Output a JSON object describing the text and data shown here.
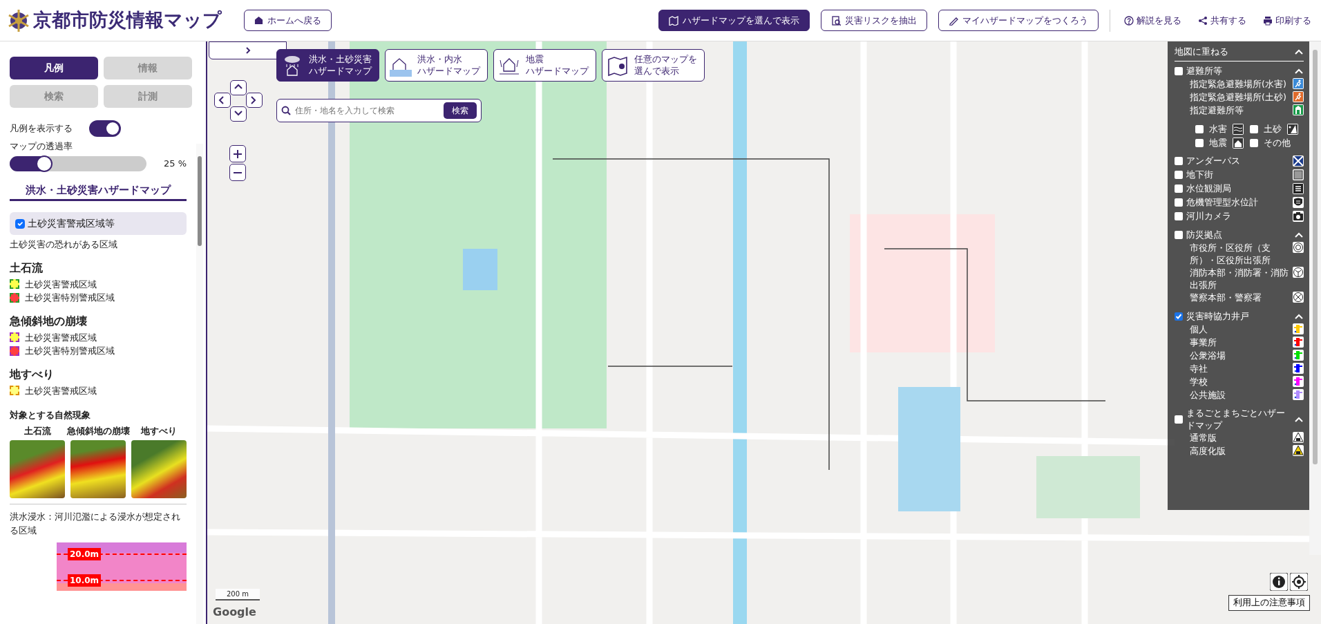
{
  "header": {
    "title": "京都市防災情報マップ",
    "home_button": "ホームへ戻る",
    "actions": [
      {
        "label": "ハザードマップを選んで表示",
        "kind": "primary"
      },
      {
        "label": "災害リスクを抽出",
        "kind": "outline"
      },
      {
        "label": "マイハザードマップをつくろう",
        "kind": "outline"
      },
      {
        "label": "解説を見る",
        "kind": "link"
      },
      {
        "label": "共有する",
        "kind": "link"
      },
      {
        "label": "印刷する",
        "kind": "link"
      }
    ]
  },
  "sidebar": {
    "tabs": [
      {
        "label": "凡例",
        "selected": true
      },
      {
        "label": "情報",
        "selected": false
      },
      {
        "label": "検索",
        "selected": false
      },
      {
        "label": "計測",
        "selected": false
      }
    ],
    "legend_toggle": {
      "label": "凡例を表示する",
      "on": true
    },
    "opacity": {
      "label": "マップの透過率",
      "level": 0.25,
      "reading": "25 %"
    },
    "section_title": "洪水・土砂災害ハザードマップ",
    "layer": {
      "label": "土砂災害警戒区域等",
      "checked": true
    },
    "layer_description": "土砂災害の恐れがある区域",
    "groups": [
      {
        "title": "土石流",
        "items": [
          {
            "label": "土砂災害警戒区域",
            "color": "#ffff4d"
          },
          {
            "label": "土砂災害特別警戒区域",
            "color": "#ff4040"
          }
        ]
      },
      {
        "title": "急傾斜地の崩壊",
        "items": [
          {
            "label": "土砂災害警戒区域",
            "color": "#ffff4d"
          },
          {
            "label": "土砂災害特別警戒区域",
            "color": "#ff4040"
          }
        ]
      },
      {
        "title": "地すべり",
        "items": [
          {
            "label": "土砂災害警戒区域",
            "color": "#ffff80"
          }
        ]
      }
    ],
    "phenomena": {
      "title": "対象とする自然現象",
      "items": [
        "土石流",
        "急傾斜地の崩壊",
        "地すべり"
      ]
    },
    "flood_description": "洪水浸水：河川氾濫による浸水が想定される区域",
    "flood_levels": [
      "20.0m",
      "10.0m"
    ]
  },
  "map": {
    "hazard_buttons": [
      {
        "lines": [
          "洪水・土砂災害",
          "ハザードマップ"
        ],
        "selected": true
      },
      {
        "lines": [
          "洪水・内水",
          "ハザードマップ"
        ],
        "selected": false
      },
      {
        "lines": [
          "地震",
          "ハザードマップ"
        ],
        "selected": false
      },
      {
        "lines": [
          "任意のマップを",
          "選んで表示"
        ],
        "selected": false
      }
    ],
    "search": {
      "placeholder": "住所・地名を入力して検索",
      "button": "検索"
    },
    "scale": "200 m",
    "attribution": "Google",
    "notice_button": "利用上の注意事項"
  },
  "overlay": {
    "title": "地図に重ねる",
    "expanded": true,
    "layers": [
      {
        "label": "避難所等",
        "checked": false,
        "expanded": true,
        "items": [
          {
            "label": "指定緊急避難場所(水害)"
          },
          {
            "label": "指定緊急避難場所(土砂)"
          },
          {
            "label": "指定避難所等"
          }
        ],
        "options": [
          {
            "label": "水害",
            "checked": false
          },
          {
            "label": "土砂",
            "checked": false
          },
          {
            "label": "地震",
            "checked": false
          },
          {
            "label": "その他",
            "checked": false
          }
        ]
      },
      {
        "label": "アンダーパス",
        "checked": false
      },
      {
        "label": "地下街",
        "checked": false
      },
      {
        "label": "水位観測局",
        "checked": false
      },
      {
        "label": "危機管理型水位計",
        "checked": false
      },
      {
        "label": "河川カメラ",
        "checked": false
      },
      {
        "label": "防災拠点",
        "checked": false,
        "expanded": true,
        "items": [
          {
            "label": "市役所・区役所（支所）・区役所出張所"
          },
          {
            "label": "消防本部・消防署・消防出張所"
          },
          {
            "label": "警察本部・警察署"
          }
        ]
      },
      {
        "label": "災害時協力井戸",
        "checked": true,
        "expanded": true,
        "items": [
          {
            "label": "個人",
            "color": "#ffc800"
          },
          {
            "label": "事業所",
            "color": "#ff0000"
          },
          {
            "label": "公衆浴場",
            "color": "#00e000"
          },
          {
            "label": "寺社",
            "color": "#0000ff"
          },
          {
            "label": "学校",
            "color": "#ff00ff"
          },
          {
            "label": "公共施設",
            "color": "#b08cff"
          }
        ]
      },
      {
        "label": "まるごとまちごとハザードマップ",
        "checked": false,
        "expanded": true,
        "items": [
          {
            "label": "通常版"
          },
          {
            "label": "高度化版"
          }
        ]
      }
    ]
  }
}
